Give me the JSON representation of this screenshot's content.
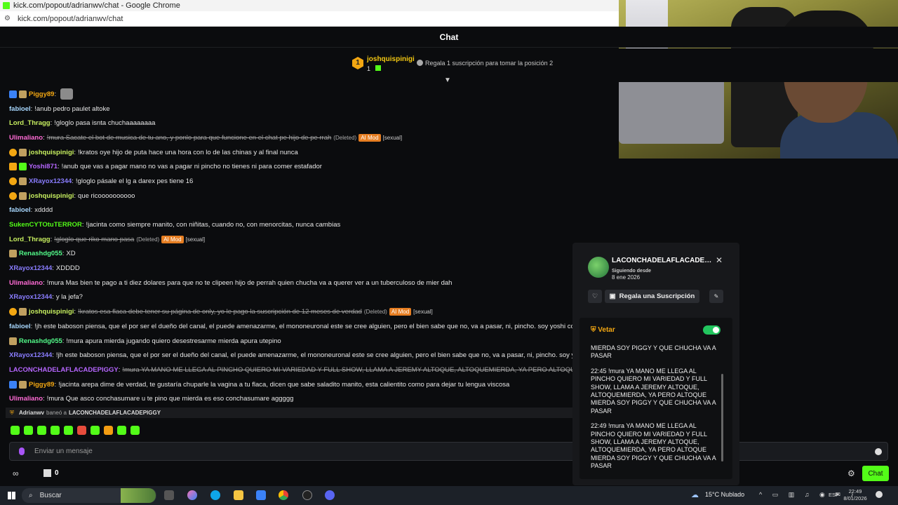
{
  "browser": {
    "window_title": "kick.com/popout/adrianwv/chat - Google Chrome",
    "url": "kick.com/popout/adrianwv/chat"
  },
  "chat": {
    "title": "Chat",
    "leaderboard": {
      "rank": "1",
      "username": "joshquispinigi",
      "count": "1",
      "hint": "Regala 1 suscripción para tomar la posición 2"
    },
    "messages": [
      {
        "badges": [
          "mod",
          "sub"
        ],
        "user": "Piggy89",
        "color": "#f3a712",
        "text": "",
        "emote": true
      },
      {
        "badges": [],
        "user": "fabioel",
        "color": "#a8d8ff",
        "text": "!anub pedro paulet altoke"
      },
      {
        "badges": [],
        "user": "Lord_Thragg",
        "color": "#c8f060",
        "text": "!gloglo pasa isnta chuchaaaaaaaa"
      },
      {
        "badges": [],
        "user": "Ulimaliano",
        "color": "#ff6bd5",
        "text": "!mura Sacate el bot de musica de tu ano, y ponlo para que funcione en el chat pe hijo de pe rrah",
        "deleted": true,
        "aimod": "AI Mod",
        "category": "[sexual]",
        "deleted_label": "(Deleted)"
      },
      {
        "badges": [
          "og",
          "sub"
        ],
        "user": "joshquispinigi",
        "color": "#c8f060",
        "text": "!kratos oye hijo de puta hace una hora con lo de las chinas y al final nunca"
      },
      {
        "badges": [
          "vip",
          "gift"
        ],
        "user": "Yoshi871",
        "color": "#b666ff",
        "text": "!anub que vas a pagar mano no vas a pagar ni pincho no tienes ni para comer estafador"
      },
      {
        "badges": [
          "og",
          "sub"
        ],
        "user": "XRayox12344",
        "color": "#8a7dff",
        "text": "!gloglo pásale el lg a darex pes tiene 16"
      },
      {
        "badges": [
          "og",
          "sub"
        ],
        "user": "joshquispinigi",
        "color": "#c8f060",
        "text": "que ricoooooooooo"
      },
      {
        "badges": [],
        "user": "fabioel",
        "color": "#a8d8ff",
        "text": "xdddd"
      },
      {
        "badges": [],
        "user": "SukenCYTOtuTERROR",
        "color": "#53fc18",
        "text": "!jacinta como siempre manito, con niñitas, cuando no, con menorcitas, nunca cambias"
      },
      {
        "badges": [],
        "user": "Lord_Thragg",
        "color": "#c8f060",
        "text": "!gloglo que riko mano pasa",
        "deleted": true,
        "aimod": "AI Mod",
        "category": "[sexual]",
        "deleted_label": "(Deleted)"
      },
      {
        "badges": [
          "sub"
        ],
        "user": "Renashdg055",
        "color": "#53fc8a",
        "text": "XD"
      },
      {
        "badges": [],
        "user": "XRayox12344",
        "color": "#8a7dff",
        "text": "XDDDD"
      },
      {
        "badges": [],
        "user": "Ulimaliano",
        "color": "#ff6bd5",
        "text": "!mura Mas bien te pago a ti diez dolares para que no te clipeen hijo de perrah quien chucha va a querer ver a un tuberculoso de mier dah"
      },
      {
        "badges": [],
        "user": "XRayox12344",
        "color": "#8a7dff",
        "text": "y la jefa?"
      },
      {
        "badges": [
          "og",
          "sub"
        ],
        "user": "joshquispinigi",
        "color": "#c8f060",
        "text": "!kratos esa flaca debe tener su página de only, yo le pago la suscripción de 12 meses de verdad",
        "deleted": true,
        "aimod": "AI Mod",
        "category": "[sexual]",
        "deleted_label": "(Deleted)"
      },
      {
        "badges": [],
        "user": "fabioel",
        "color": "#a8d8ff",
        "text": "!jh este baboson piensa, que el por ser el dueño del canal, el puede amenazarme, el mononeuronal este se cree alguien, pero el bien sabe que no, va a pasar, ni, pincho. soy yoshi conchetu"
      },
      {
        "badges": [
          "sub"
        ],
        "user": "Renashdg055",
        "color": "#53fc8a",
        "text": "!mura apura mierda jugando quiero desestresarme mierda apura utepino"
      },
      {
        "badges": [],
        "user": "XRayox12344",
        "color": "#8a7dff",
        "text": "!jh este baboson piensa, que el por ser el dueño del canal, el puede amenazarme, el mononeuronal este se cree alguien, pero el bien sabe que no, va a pasar, ni, pincho. soy yoshi c"
      },
      {
        "badges": [],
        "user": "LACONCHADELAFLACADEPIGGY",
        "color": "#b666ff",
        "text": "!mura YA MANO ME LLEGA AL PINCHO QUIERO MI VARIEDAD Y FULL SHOW, LLAMA A JEREMY ALTOQUE, ALTOQUEMIERDA, YA PERO ALTOQUE MIERDA SOY",
        "deleted": true
      },
      {
        "badges": [
          "mod",
          "sub"
        ],
        "user": "Piggy89",
        "color": "#f3a712",
        "text": "!jacinta arepa dime de verdad, te gustaría chuparle la vagina a tu flaca, dicen que sabe saladito manito, esta calientito como para dejar tu lengua viscosa"
      },
      {
        "badges": [],
        "user": "Ulimaliano",
        "color": "#ff6bd5",
        "text": "!mura Que asco conchasumare u te pino que mierda es eso conchasumare aggggg"
      }
    ],
    "ban_notice": {
      "actor": "Adrianwv",
      "action": "baneó a",
      "target": "LACONCHADELAFLACADEPIGGY"
    },
    "input_placeholder": "Enviar un mensaje",
    "bottom": {
      "infinite": "∞",
      "gift_count": "0",
      "chat_button": "Chat",
      "gear": "⚙"
    }
  },
  "usercard": {
    "username": "LACONCHADELAFLACADEPI...",
    "following_label": "Siguiendo desde",
    "following_date": "8 ene 2026",
    "gift_sub_label": "Regala una Suscripción",
    "vetar_label": "Vetar",
    "vetar_enabled": true,
    "log": [
      "MIERDA SOY PIGGY Y QUE CHUCHA VA A PASAR",
      "22:45 !mura YA MANO ME LLEGA AL PINCHO QUIERO MI VARIEDAD Y FULL SHOW, LLAMA A JEREMY ALTOQUE, ALTOQUEMIERDA, YA PERO ALTOQUE MIERDA SOY PIGGY Y QUE CHUCHA VA A PASAR",
      "22:49 !mura YA MANO ME LLEGA AL PINCHO QUIERO MI VARIEDAD Y FULL SHOW, LLAMA A JEREMY ALTOQUE, ALTOQUEMIERDA, YA PERO ALTOQUE MIERDA SOY PIGGY Y QUE CHUCHA VA A PASAR"
    ],
    "close": "✕"
  },
  "taskbar": {
    "search_label": "Buscar",
    "weather": "15°C  Nublado",
    "lang": "ESP",
    "time": "22:49",
    "date": "8/01/2026"
  },
  "colors": {
    "accent": "#53fc18",
    "background": "#0b0c0e",
    "mod_orange": "#e67e22"
  }
}
